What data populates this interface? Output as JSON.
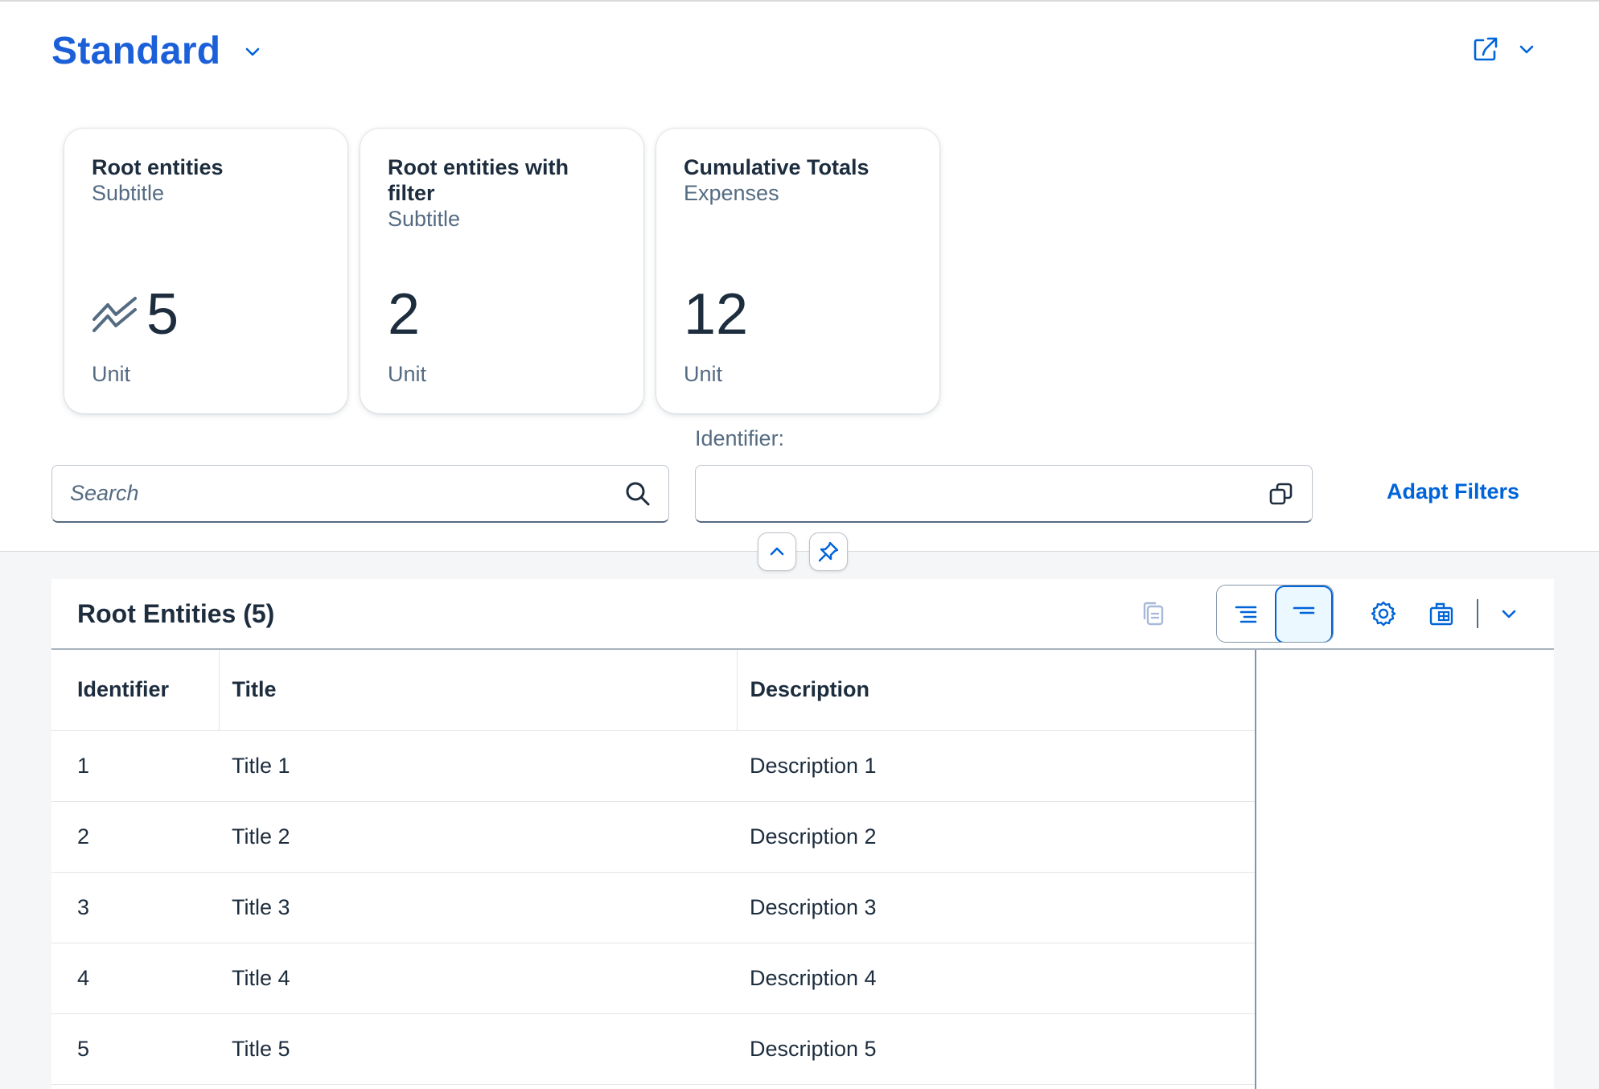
{
  "header": {
    "variant_title": "Standard",
    "kpi_tiles": [
      {
        "title": "Root entities",
        "subtitle": "Subtitle",
        "value": "5",
        "unit": "Unit",
        "trend_icon": "trend-icon"
      },
      {
        "title": "Root entities with filter",
        "subtitle": "Subtitle",
        "value": "2",
        "unit": "Unit"
      },
      {
        "title": "Cumulative Totals",
        "subtitle": "Expenses",
        "value": "12",
        "unit": "Unit"
      }
    ]
  },
  "filters": {
    "search_placeholder": "Search",
    "identifier_label": "Identifier:",
    "identifier_value": "",
    "adapt_filters_label": "Adapt Filters"
  },
  "table": {
    "title": "Root Entities (5)",
    "columns": [
      "Identifier",
      "Title",
      "Description"
    ],
    "rows": [
      [
        "1",
        "Title 1",
        "Description 1"
      ],
      [
        "2",
        "Title 2",
        "Description 2"
      ],
      [
        "3",
        "Title 3",
        "Description 3"
      ],
      [
        "4",
        "Title 4",
        "Description 4"
      ],
      [
        "5",
        "Title 5",
        "Description 5"
      ]
    ]
  },
  "colors": {
    "accent": "#0064d9",
    "variant_title": "#1b5fd9",
    "text": "#1d2d3e",
    "secondary_text": "#556b82",
    "background": "#f5f6f7"
  }
}
